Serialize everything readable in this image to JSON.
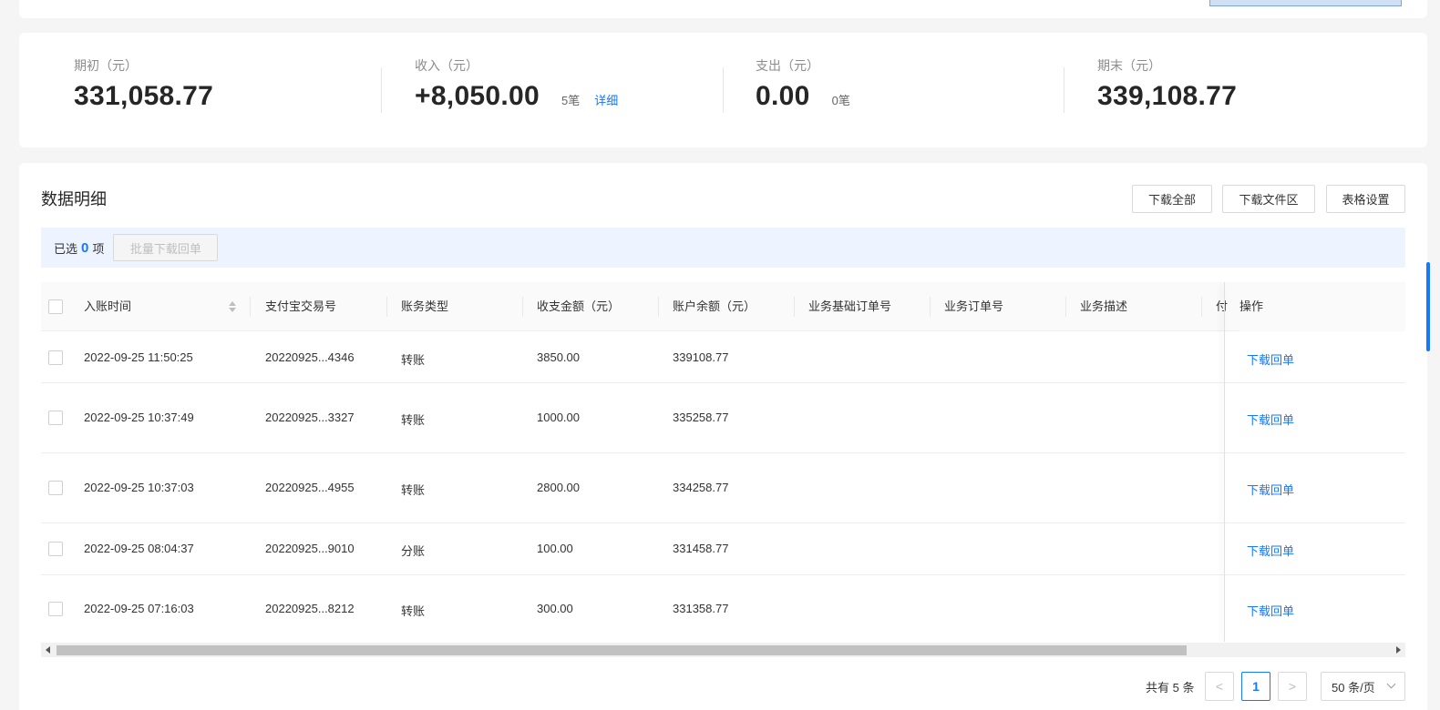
{
  "summary": {
    "opening": {
      "label": "期初（元）",
      "value": "331,058.77"
    },
    "income": {
      "label": "收入（元）",
      "value": "+8,050.00",
      "count": "5笔",
      "detail_link": "详细"
    },
    "expense": {
      "label": "支出（元）",
      "value": "0.00",
      "count": "0笔"
    },
    "closing": {
      "label": "期末（元）",
      "value": "339,108.77"
    }
  },
  "detail": {
    "title": "数据明细",
    "buttons": {
      "download_all": "下载全部",
      "download_files": "下载文件区",
      "table_settings": "表格设置"
    },
    "selection": {
      "prefix": "已选",
      "count": "0",
      "suffix": "项",
      "batch_button": "批量下载回单"
    }
  },
  "table": {
    "columns": [
      "入账时间",
      "支付宝交易号",
      "账务类型",
      "收支金额（元）",
      "账户余额（元）",
      "业务基础订单号",
      "业务订单号",
      "业务描述",
      "付",
      "操作"
    ],
    "rows": [
      {
        "time": "2022-09-25 11:50:25",
        "trade_no": "20220925...4346",
        "type": "转账",
        "amount": "3850.00",
        "balance": "339108.77",
        "action": "下载回单"
      },
      {
        "time": "2022-09-25 10:37:49",
        "trade_no": "20220925...3327",
        "type": "转账",
        "amount": "1000.00",
        "balance": "335258.77",
        "action": "下载回单"
      },
      {
        "time": "2022-09-25 10:37:03",
        "trade_no": "20220925...4955",
        "type": "转账",
        "amount": "2800.00",
        "balance": "334258.77",
        "action": "下载回单"
      },
      {
        "time": "2022-09-25 08:04:37",
        "trade_no": "20220925...9010",
        "type": "分账",
        "amount": "100.00",
        "balance": "331458.77",
        "action": "下载回单"
      },
      {
        "time": "2022-09-25 07:16:03",
        "trade_no": "20220925...8212",
        "type": "转账",
        "amount": "300.00",
        "balance": "331358.77",
        "action": "下载回单"
      }
    ]
  },
  "pagination": {
    "total": "共有 5 条",
    "prev": "<",
    "current": "1",
    "next": ">",
    "page_size": "50 条/页"
  }
}
